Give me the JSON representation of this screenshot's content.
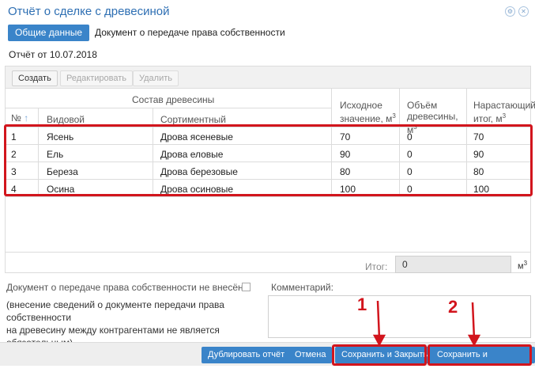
{
  "window": {
    "title": "Отчёт о сделке с древесиной",
    "icons": [
      "settings-icon",
      "close-icon"
    ]
  },
  "tabs": [
    {
      "label": "Общие данные",
      "active": true
    },
    {
      "label": "Документ о передаче права собственности",
      "active": false
    }
  ],
  "report_date": "Отчёт от 10.07.2018",
  "toolbar": {
    "create": "Создать",
    "edit": "Редактировать",
    "delete": "Удалить"
  },
  "table": {
    "group_header": "Состав древесины",
    "columns": {
      "num": "№",
      "species": "Видовой",
      "assortment": "Сортиментный",
      "initial": "Исходное значение, м",
      "volume": "Объём древесины, м",
      "cumulative": "Нарастающий итог, м",
      "sup": "3"
    },
    "rows": [
      {
        "num": "1",
        "species": "Ясень",
        "assortment": "Дрова ясеневые",
        "initial": "70",
        "volume": "0",
        "cumulative": "70"
      },
      {
        "num": "2",
        "species": "Ель",
        "assortment": "Дрова еловые",
        "initial": "90",
        "volume": "0",
        "cumulative": "90"
      },
      {
        "num": "3",
        "species": "Береза",
        "assortment": "Дрова березовые",
        "initial": "80",
        "volume": "0",
        "cumulative": "80"
      },
      {
        "num": "4",
        "species": "Осина",
        "assortment": "Дрова осиновые",
        "initial": "100",
        "volume": "0",
        "cumulative": "100"
      }
    ],
    "total_label": "Итог:",
    "total_value": "0",
    "total_unit": "м",
    "total_unit_sup": "3"
  },
  "form": {
    "doc_label": "Документ о передаче права собственности не внесён:",
    "comment_label": "Комментарий:",
    "note_line1": "(внесение сведений о документе передачи права собственности",
    "note_line2": "на древесину между контрагентами не является обязательным)"
  },
  "footer": {
    "duplicate": "Дублировать отчёт",
    "cancel": "Отмена",
    "save_close": "Сохранить и Закрыть",
    "save_sign": "Сохранить и Подписать"
  },
  "annotations": {
    "callout1": "1",
    "callout2": "2",
    "color": "#d2151d"
  },
  "colors": {
    "accent": "#3a84c9",
    "title": "#2e6fb3",
    "highlight": "#d2151d"
  }
}
